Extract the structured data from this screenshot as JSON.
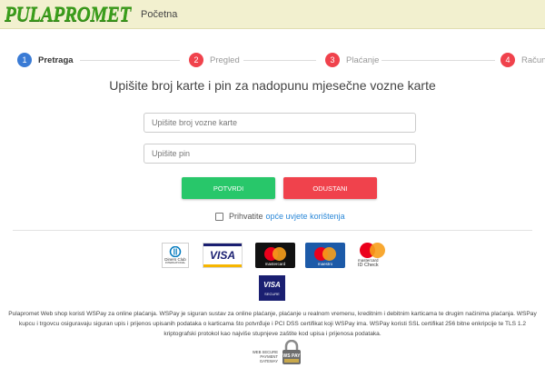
{
  "header": {
    "logo": "PULAPROMET",
    "nav_home": "Početna"
  },
  "steps": [
    {
      "number": "1",
      "label": "Pretraga",
      "color": "#3a7bd5",
      "active": true
    },
    {
      "number": "2",
      "label": "Pregled",
      "color": "#f0424c",
      "active": false
    },
    {
      "number": "3",
      "label": "Plaćanje",
      "color": "#f0424c",
      "active": false
    },
    {
      "number": "4",
      "label": "Račun",
      "color": "#f0424c",
      "active": false
    }
  ],
  "form": {
    "heading": "Upišite broj karte i pin za nadopunu mjesečne vozne karte",
    "card_number_placeholder": "Upišite broj vozne karte",
    "pin_placeholder": "Upišite pin",
    "confirm_label": "POTVRDI",
    "cancel_label": "ODUSTANI",
    "terms_prefix": "Prihvatite",
    "terms_link": "opće uvjete korištenja"
  },
  "payment_logos": {
    "diners": "Diners Club",
    "diners_sub": "INTERNATIONAL",
    "visa": "VISA",
    "mastercard": "mastercard",
    "maestro": "maestro",
    "mastercard_idcheck": "mastercard",
    "idcheck": "ID Check",
    "visa_secure_brand": "VISA",
    "visa_secure": "SECURE"
  },
  "notice": "Pulapromet Web shop koristi WSPay za online plaćanja. WSPay je siguran sustav za online plaćanje, plaćanje u realnom vremenu, kreditnim i debitnim karticama te drugim načinima plaćanja. WSPay kupcu i trgovcu osiguravaju siguran upis i prijenos upisanih podataka o karticama što potvrđuje i PCI DSS certifikat koji WSPay ima. WSPay koristi SSL certifikat 256 bitne enkripcije te TLS 1.2 kriptografski protokol kao najviše stupnjeve zaštite kod upisa i prijenosa podataka.",
  "wspay": {
    "line1": "WEB SECURE",
    "line2": "PAYMENT",
    "line3": "GATEWAY",
    "logo_text": "WS PAY"
  },
  "colors": {
    "accent_green": "#28c76a",
    "accent_red": "#f0424c",
    "link": "#2b88d8",
    "header_bg": "#f2f0cf",
    "logo_green": "#3a9e1b"
  }
}
